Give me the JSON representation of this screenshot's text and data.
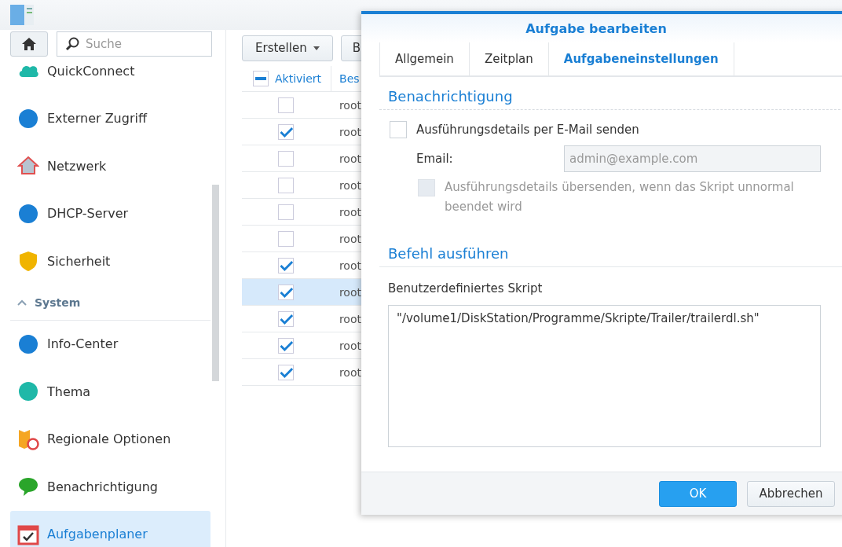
{
  "sidebar": {
    "search": {
      "placeholder": "Suche"
    },
    "items": [
      {
        "label": "QuickConnect",
        "selected": false
      },
      {
        "label": "Externer Zugriff",
        "selected": false
      },
      {
        "label": "Netzwerk",
        "selected": false
      },
      {
        "label": "DHCP-Server",
        "selected": false
      },
      {
        "label": "Sicherheit",
        "selected": false
      },
      {
        "kind": "section",
        "label": "System",
        "expanded": true
      },
      {
        "label": "Info-Center",
        "selected": false
      },
      {
        "label": "Thema",
        "selected": false
      },
      {
        "label": "Regionale Optionen",
        "selected": false
      },
      {
        "label": "Benachrichtigung",
        "selected": false
      },
      {
        "label": "Aufgabenplaner",
        "selected": true
      }
    ]
  },
  "toolbar": {
    "buttons": [
      {
        "label": "Erstellen",
        "kind": "menu"
      },
      {
        "label": "B",
        "kind": "plain"
      }
    ]
  },
  "table": {
    "columns": [
      {
        "label": "Aktiviert",
        "indeterminate": true
      },
      {
        "label": "Bes"
      }
    ],
    "rows": [
      {
        "checked": false,
        "owner": "root",
        "selected": false
      },
      {
        "checked": true,
        "owner": "root",
        "selected": false
      },
      {
        "checked": false,
        "owner": "root",
        "selected": false
      },
      {
        "checked": false,
        "owner": "root",
        "selected": false
      },
      {
        "checked": false,
        "owner": "root",
        "selected": false
      },
      {
        "checked": false,
        "owner": "root",
        "selected": false
      },
      {
        "checked": true,
        "owner": "root",
        "selected": false
      },
      {
        "checked": true,
        "owner": "root",
        "selected": true
      },
      {
        "checked": true,
        "owner": "root",
        "selected": false
      },
      {
        "checked": true,
        "owner": "root",
        "selected": false
      },
      {
        "checked": true,
        "owner": "root",
        "selected": false
      }
    ]
  },
  "dialog": {
    "title": "Aufgabe bearbeiten",
    "tabs": [
      {
        "label": "Allgemein",
        "selected": false
      },
      {
        "label": "Zeitplan",
        "selected": false
      },
      {
        "label": "Aufgabeneinstellungen",
        "selected": true
      }
    ],
    "notification": {
      "heading": "Benachrichtigung",
      "send_email": {
        "label": "Ausführungsdetails per E-Mail senden",
        "checked": false
      },
      "email": {
        "label": "Email:",
        "placeholder": "admin@example.com",
        "disabled": true
      },
      "on_error": {
        "label": "Ausführungsdetails übersenden, wenn das Skript unnormal beendet wird",
        "checked": false,
        "disabled": true
      }
    },
    "command": {
      "heading": "Befehl ausführen",
      "script_label": "Benutzerdefiniertes Skript",
      "script": "\"/volume1/DiskStation/Programme/Skripte/Trailer/trailerdl.sh\""
    },
    "buttons": [
      {
        "label": "OK",
        "kind": "primary"
      },
      {
        "label": "Abbrechen",
        "kind": "secondary"
      }
    ]
  }
}
